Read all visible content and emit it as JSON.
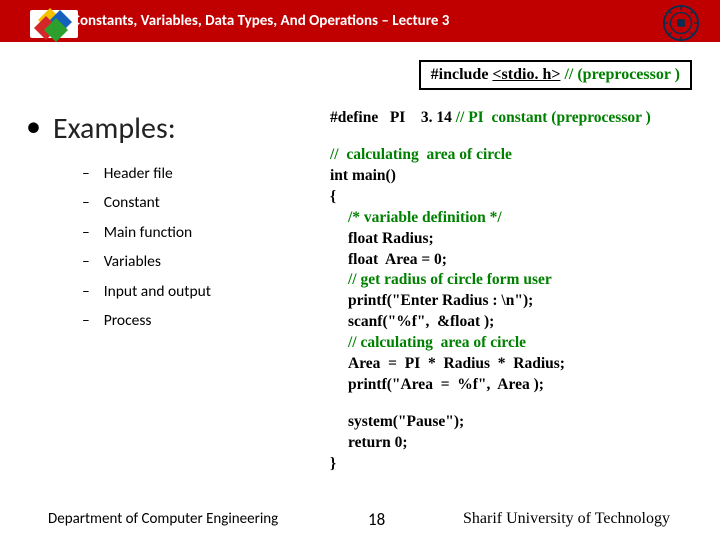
{
  "header": {
    "title": "Constants, Variables, Data Types, And Operations – Lecture 3"
  },
  "codebox": {
    "pre": "#include ",
    "hdr": "<stdio. h>",
    "cmt": " // (preprocessor )"
  },
  "left": {
    "title": "Examples:",
    "items": [
      "Header file",
      "Constant",
      "Main function",
      "Variables",
      "Input and output",
      "Process"
    ]
  },
  "code": {
    "l1a": "#define   PI    3. 14 ",
    "l1b": "// PI  constant (preprocessor )",
    "l2": "//  calculating  area of circle",
    "l3": "int main()",
    "l4": "{",
    "l5": "/* variable definition */",
    "l6": "float Radius;",
    "l7": "float  Area = 0;",
    "l8": "// get radius of circle form user",
    "l9": "printf(\"Enter Radius : \\n\");",
    "l10": "scanf(\"%f\",  &float );",
    "l11": "// calculating  area of circle",
    "l12": "Area  =  PI  *  Radius  *  Radius;",
    "l13": "printf(\"Area  =  %f\",  Area );",
    "l14": "system(\"Pause\");",
    "l15": "return 0;",
    "l16": "}"
  },
  "footer": {
    "left": "Department of Computer Engineering",
    "page": "18",
    "right": "Sharif University of Technology"
  }
}
